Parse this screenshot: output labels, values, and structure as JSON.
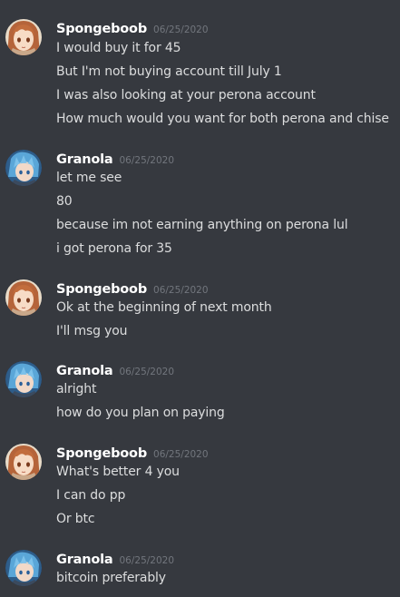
{
  "groups": [
    {
      "author": "Spongeboob",
      "avatar_icon": "anime-girl-brown-hair-avatar",
      "timestamp": "06/25/2020",
      "messages": [
        "I would buy it for 45",
        "But I'm not buying account till July 1",
        "I was also looking at your perona account",
        "How much would you want for both perona and chise"
      ]
    },
    {
      "author": "Granola",
      "avatar_icon": "anime-boy-blue-hair-avatar",
      "timestamp": "06/25/2020",
      "messages": [
        "let me see",
        "80",
        "because im not earning anything on perona lul",
        "i got perona for 35"
      ]
    },
    {
      "author": "Spongeboob",
      "avatar_icon": "anime-girl-brown-hair-avatar",
      "timestamp": "06/25/2020",
      "messages": [
        "Ok at the beginning of next month",
        "I'll msg you"
      ]
    },
    {
      "author": "Granola",
      "avatar_icon": "anime-boy-blue-hair-avatar",
      "timestamp": "06/25/2020",
      "messages": [
        "alright",
        "how do you plan on paying"
      ]
    },
    {
      "author": "Spongeboob",
      "avatar_icon": "anime-girl-brown-hair-avatar",
      "timestamp": "06/25/2020",
      "messages": [
        "What's better 4 you",
        "I can do pp",
        "Or btc"
      ]
    },
    {
      "author": "Granola",
      "avatar_icon": "anime-boy-blue-hair-avatar",
      "timestamp": "06/25/2020",
      "messages": [
        "bitcoin preferably"
      ]
    }
  ],
  "colors": {
    "background": "#36393f",
    "username": "#ffffff",
    "timestamp": "#72767d",
    "message_text": "#dcddde"
  }
}
